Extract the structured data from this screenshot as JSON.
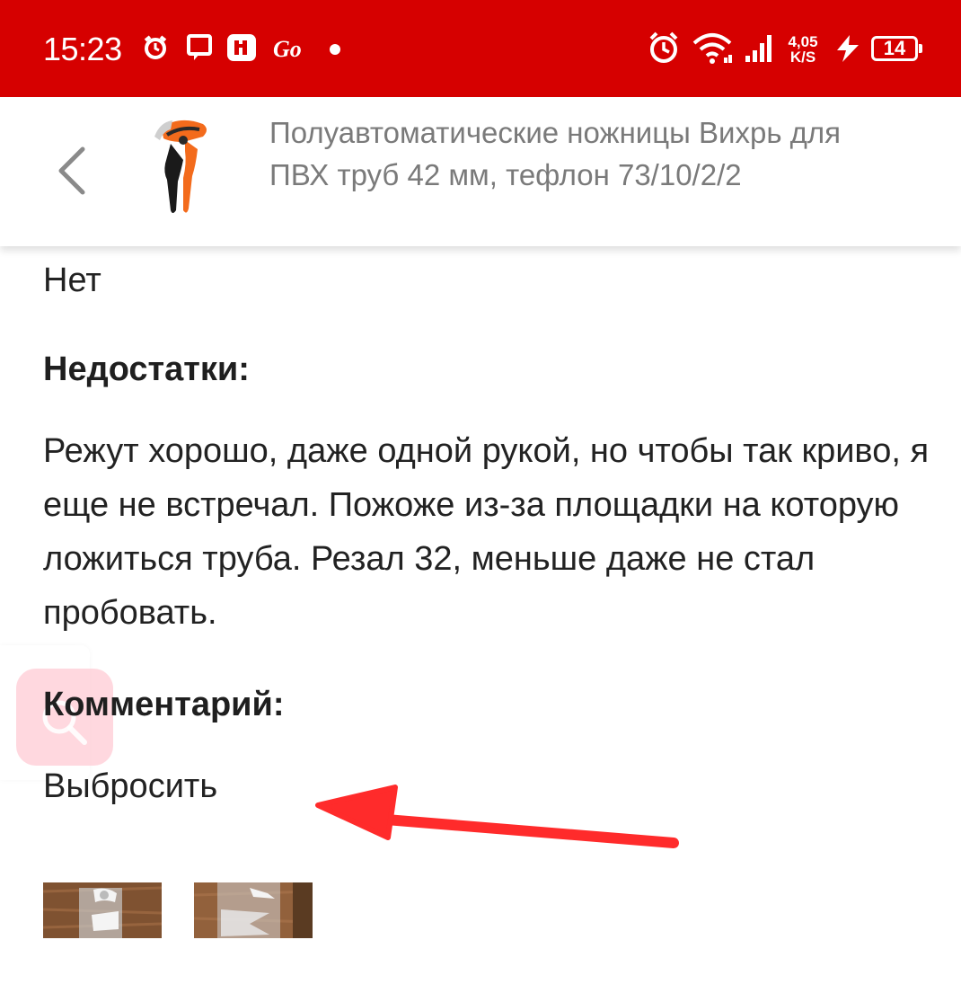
{
  "status_bar": {
    "time": "15:23",
    "net_speed_value": "4,05",
    "net_speed_unit": "K/S",
    "battery_level": "14",
    "icons": [
      "alarm-icon",
      "message-icon",
      "app-notification-icon",
      "go-icon",
      "dot-icon",
      "alarm-clock-icon",
      "wifi-icon",
      "signal-icon",
      "charging-icon",
      "battery-icon"
    ],
    "color": "#d60000"
  },
  "header": {
    "product_title": "Полуавтоматические ножницы Вихрь для ПВХ труб 42 мм, тефлон 73/10/2/2"
  },
  "review": {
    "pros_value": "Нет",
    "cons_label": "Недостатки:",
    "cons_value": "Режут хорошо, даже одной рукой, но чтобы так криво, я еще не встречал. Пожоже из-за площадки на которую ложиться труба. Резал 32, меньше даже не стал пробовать.",
    "comment_label": "Комментарий:",
    "comment_value": "Выбросить"
  },
  "photos": [
    "photo-1",
    "photo-2"
  ],
  "annotation_color": "#ff2b2b"
}
